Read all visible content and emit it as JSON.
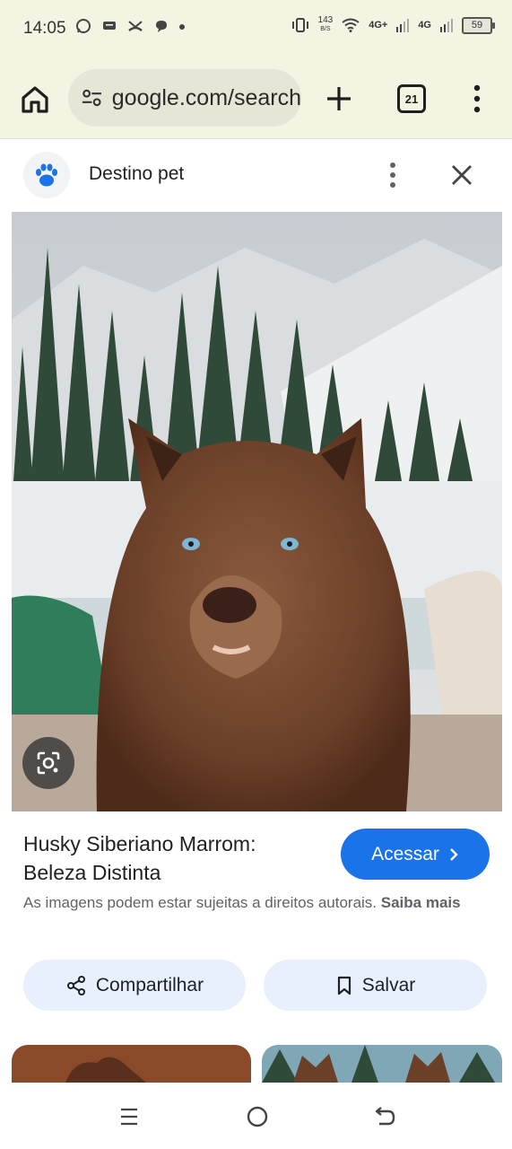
{
  "status_bar": {
    "time": "14:05",
    "speed_value": "143",
    "speed_unit": "B/S",
    "network_1": "4G+",
    "network_2": "4G",
    "battery": "59",
    "icons": [
      "whatsapp-icon",
      "message-icon",
      "missed-call-icon",
      "chat-bubble-icon",
      "dot-icon",
      "vibrate-icon",
      "wifi-icon",
      "signal-icon",
      "battery-icon"
    ]
  },
  "toolbar": {
    "url": "google.com/search",
    "tab_count": "21",
    "icons": [
      "home-icon",
      "site-settings-icon",
      "plus-icon",
      "tabs-icon",
      "menu-icon"
    ]
  },
  "sheet": {
    "site_name": "Destino pet",
    "logo_icon": "paw-icon"
  },
  "result": {
    "title": "Husky Siberiano Marrom: Beleza Distinta",
    "visit_label": "Acessar",
    "copyright_text": "As imagens podem estar sujeitas a direitos autorais.",
    "learn_more": "Saiba mais",
    "share_label": "Compartilhar",
    "save_label": "Salvar"
  },
  "colors": {
    "chrome_bg": "#f5f4e3",
    "accent": "#1a73e8",
    "pill_bg": "#e8f0fe"
  }
}
